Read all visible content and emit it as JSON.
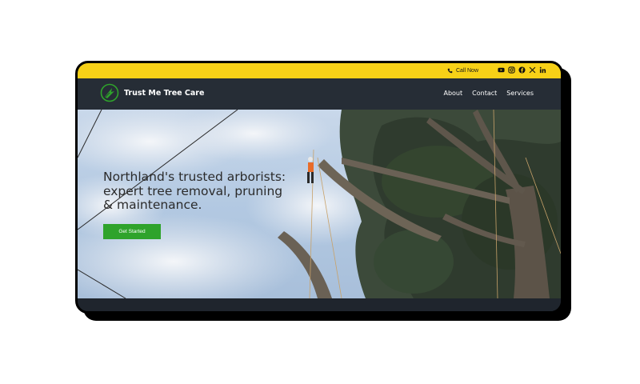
{
  "topbar": {
    "call_label": "Call Now",
    "socials": [
      "youtube-icon",
      "instagram-icon",
      "facebook-icon",
      "x-icon",
      "linkedin-icon"
    ],
    "background": "#f7d117"
  },
  "brand": {
    "name": "Trust Me Tree Care",
    "logo_icon": "tree-logo-icon",
    "accent": "#2fa32b"
  },
  "nav": {
    "items": [
      {
        "label": "About"
      },
      {
        "label": "Contact"
      },
      {
        "label": "Services"
      }
    ]
  },
  "hero": {
    "headline": "Northland's trusted arborists: expert tree removal, pruning & maintenance.",
    "cta_label": "Get Started",
    "image_subject": "arborist-climbing-tree-photo"
  },
  "colors": {
    "navbar": "#262d36",
    "button": "#2fa32b",
    "sky": "#b9cfe6"
  }
}
